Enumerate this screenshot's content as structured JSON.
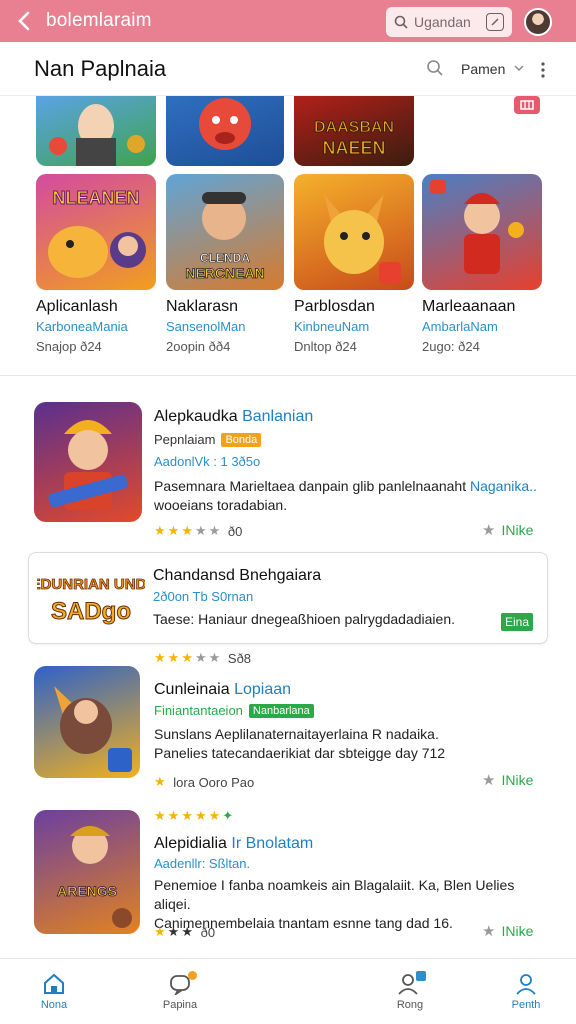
{
  "topbar": {
    "title": "bolemlaraim",
    "search_placeholder": "Ugandan",
    "bg": "#e98092"
  },
  "header": {
    "title": "Nan Paplnaia",
    "menu_label": "Pamen"
  },
  "grid": [
    {
      "label": "Aplicanlash",
      "sub": "KarboneaMania",
      "meta": "Snajop ð24"
    },
    {
      "label": "Naklarasn",
      "sub": "SansenolMan",
      "meta": "2oopin ðð4"
    },
    {
      "label": "Parblosdan",
      "sub": "KinbneuNam",
      "meta": "Dnltop ð24"
    },
    {
      "label": "Marleaanaan",
      "sub": "AmbarlaNam",
      "meta": "2ugo: ð24"
    }
  ],
  "tile_art": [
    {
      "text": "",
      "c1": "#5aa3e6",
      "c2": "#3fa34d"
    },
    {
      "text": "",
      "c1": "#2f6fbf",
      "c2": "#e84a3a"
    },
    {
      "text": "DAASBAN NAEEN",
      "c1": "#b2201a",
      "c2": "#3a1d0f"
    },
    {
      "text": "NLEANEN",
      "c1": "#d24ba0",
      "c2": "#f29e1f"
    },
    {
      "text": "CLENDA NERCNEAN",
      "c1": "#5fa5d8",
      "c2": "#d87a2c"
    },
    {
      "text": "",
      "c1": "#f5b12b",
      "c2": "#c84b1a"
    },
    {
      "text": "",
      "c1": "#4a7fc5",
      "c2": "#e7402e"
    }
  ],
  "list": [
    {
      "title": "Alepkaudka",
      "title_accent": "Banlanian",
      "dev": "Pepnlaiam",
      "dev_badge": "Bonda",
      "info": "AadonlVk : 1 3ð5o",
      "desc": "Pasemnara Marieltaea danpain glib panlelnaanaht",
      "desc_accent": "Naganika..",
      "desc2": "wooeians toradabian.",
      "rating_text": "ð0",
      "stars": 4,
      "like": "INike"
    },
    {
      "title": "Chandansd Bnehgaiara",
      "title_accent": "",
      "info": "2ð0on Tb S0rnan",
      "desc": "Taese: Haniaur dnegeaßhioen palrygdadadiaien.",
      "card_badge": "Eina",
      "rating_text": "Sð8",
      "stars": 3
    },
    {
      "title": "Cunleinaia",
      "title_accent": "Lopiaan",
      "dev": "Finiantantaeion",
      "dev_badge": "Nanbarlana",
      "desc": "Sunslans Aeplilanaternaitayerlaina R nadaika.",
      "desc2": "Panelies tatecandaerikiat dar sbteigge day 712",
      "rating_text": "lora Ooro Pao",
      "like": "INike"
    },
    {
      "title": "Alepidialia",
      "title_accent": "Ir Bnolatam",
      "info": "Aadenllr: Sßltan.",
      "desc": "Penemioe I fanba noamkeis ain Blagalaiit. Ka, Blen Uelies aliqei.",
      "desc2": "Canimennembelaia tnantam esnne tang dad 16.",
      "rating_text": "ð0",
      "stars": 3,
      "like": "INike"
    }
  ],
  "tile_art_labels": {
    "small_art_4": "SADgo",
    "small_art_1": "DEDUNRIAN UNDIO"
  },
  "bottom_nav": [
    {
      "label": "Nona"
    },
    {
      "label": "Papina"
    },
    {
      "label": "Rong"
    },
    {
      "label": "Penth"
    }
  ]
}
